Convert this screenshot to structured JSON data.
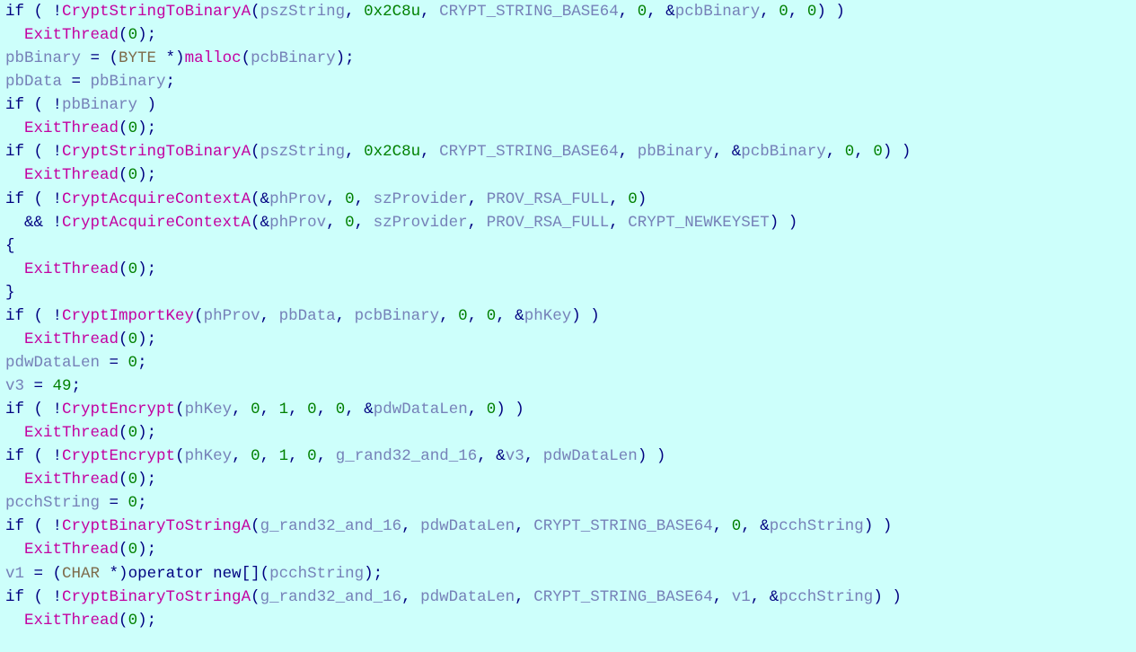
{
  "lines": [
    [
      {
        "cls": "kw",
        "t": "if"
      },
      {
        "cls": "op",
        "t": " ("
      },
      {
        "cls": "op",
        "t": " !"
      },
      {
        "cls": "fn",
        "t": "CryptStringToBinaryA"
      },
      {
        "cls": "op",
        "t": "("
      },
      {
        "cls": "var",
        "t": "pszString"
      },
      {
        "cls": "op",
        "t": ", "
      },
      {
        "cls": "lt",
        "t": "0x2C8u"
      },
      {
        "cls": "op",
        "t": ", "
      },
      {
        "cls": "var",
        "t": "CRYPT_STRING_BASE64"
      },
      {
        "cls": "op",
        "t": ", "
      },
      {
        "cls": "lt",
        "t": "0"
      },
      {
        "cls": "op",
        "t": ", &"
      },
      {
        "cls": "var",
        "t": "pcbBinary"
      },
      {
        "cls": "op",
        "t": ", "
      },
      {
        "cls": "lt",
        "t": "0"
      },
      {
        "cls": "op",
        "t": ", "
      },
      {
        "cls": "lt",
        "t": "0"
      },
      {
        "cls": "op",
        "t": ")"
      },
      {
        "cls": "op",
        "t": " )"
      }
    ],
    [
      {
        "cls": "op",
        "t": "  "
      },
      {
        "cls": "fn",
        "t": "ExitThread"
      },
      {
        "cls": "op",
        "t": "("
      },
      {
        "cls": "lt",
        "t": "0"
      },
      {
        "cls": "op",
        "t": ");"
      }
    ],
    [
      {
        "cls": "var",
        "t": "pbBinary"
      },
      {
        "cls": "op",
        "t": " = ("
      },
      {
        "cls": "ty",
        "t": "BYTE"
      },
      {
        "cls": "op",
        "t": " *)"
      },
      {
        "cls": "fn",
        "t": "malloc"
      },
      {
        "cls": "op",
        "t": "("
      },
      {
        "cls": "var",
        "t": "pcbBinary"
      },
      {
        "cls": "op",
        "t": ");"
      }
    ],
    [
      {
        "cls": "var",
        "t": "pbData"
      },
      {
        "cls": "op",
        "t": " = "
      },
      {
        "cls": "var",
        "t": "pbBinary"
      },
      {
        "cls": "op",
        "t": ";"
      }
    ],
    [
      {
        "cls": "kw",
        "t": "if"
      },
      {
        "cls": "op",
        "t": " ( !"
      },
      {
        "cls": "var",
        "t": "pbBinary"
      },
      {
        "cls": "op",
        "t": " )"
      }
    ],
    [
      {
        "cls": "op",
        "t": "  "
      },
      {
        "cls": "fn",
        "t": "ExitThread"
      },
      {
        "cls": "op",
        "t": "("
      },
      {
        "cls": "lt",
        "t": "0"
      },
      {
        "cls": "op",
        "t": ");"
      }
    ],
    [
      {
        "cls": "kw",
        "t": "if"
      },
      {
        "cls": "op",
        "t": " ( !"
      },
      {
        "cls": "fn",
        "t": "CryptStringToBinaryA"
      },
      {
        "cls": "op",
        "t": "("
      },
      {
        "cls": "var",
        "t": "pszString"
      },
      {
        "cls": "op",
        "t": ", "
      },
      {
        "cls": "lt",
        "t": "0x2C8u"
      },
      {
        "cls": "op",
        "t": ", "
      },
      {
        "cls": "var",
        "t": "CRYPT_STRING_BASE64"
      },
      {
        "cls": "op",
        "t": ", "
      },
      {
        "cls": "var",
        "t": "pbBinary"
      },
      {
        "cls": "op",
        "t": ", &"
      },
      {
        "cls": "var",
        "t": "pcbBinary"
      },
      {
        "cls": "op",
        "t": ", "
      },
      {
        "cls": "lt",
        "t": "0"
      },
      {
        "cls": "op",
        "t": ", "
      },
      {
        "cls": "lt",
        "t": "0"
      },
      {
        "cls": "op",
        "t": ") )"
      }
    ],
    [
      {
        "cls": "op",
        "t": "  "
      },
      {
        "cls": "fn",
        "t": "ExitThread"
      },
      {
        "cls": "op",
        "t": "("
      },
      {
        "cls": "lt",
        "t": "0"
      },
      {
        "cls": "op",
        "t": ");"
      }
    ],
    [
      {
        "cls": "kw",
        "t": "if"
      },
      {
        "cls": "op",
        "t": " ( !"
      },
      {
        "cls": "fn",
        "t": "CryptAcquireContextA"
      },
      {
        "cls": "op",
        "t": "(&"
      },
      {
        "cls": "var",
        "t": "phProv"
      },
      {
        "cls": "op",
        "t": ", "
      },
      {
        "cls": "lt",
        "t": "0"
      },
      {
        "cls": "op",
        "t": ", "
      },
      {
        "cls": "var",
        "t": "szProvider"
      },
      {
        "cls": "op",
        "t": ", "
      },
      {
        "cls": "var",
        "t": "PROV_RSA_FULL"
      },
      {
        "cls": "op",
        "t": ", "
      },
      {
        "cls": "lt",
        "t": "0"
      },
      {
        "cls": "op",
        "t": ")"
      }
    ],
    [
      {
        "cls": "op",
        "t": "  && !"
      },
      {
        "cls": "fn",
        "t": "CryptAcquireContextA"
      },
      {
        "cls": "op",
        "t": "(&"
      },
      {
        "cls": "var",
        "t": "phProv"
      },
      {
        "cls": "op",
        "t": ", "
      },
      {
        "cls": "lt",
        "t": "0"
      },
      {
        "cls": "op",
        "t": ", "
      },
      {
        "cls": "var",
        "t": "szProvider"
      },
      {
        "cls": "op",
        "t": ", "
      },
      {
        "cls": "var",
        "t": "PROV_RSA_FULL"
      },
      {
        "cls": "op",
        "t": ", "
      },
      {
        "cls": "var",
        "t": "CRYPT_NEWKEYSET"
      },
      {
        "cls": "op",
        "t": ") )"
      }
    ],
    [
      {
        "cls": "op",
        "t": "{"
      }
    ],
    [
      {
        "cls": "op",
        "t": "  "
      },
      {
        "cls": "fn",
        "t": "ExitThread"
      },
      {
        "cls": "op",
        "t": "("
      },
      {
        "cls": "lt",
        "t": "0"
      },
      {
        "cls": "op",
        "t": ");"
      }
    ],
    [
      {
        "cls": "op",
        "t": "}"
      }
    ],
    [
      {
        "cls": "kw",
        "t": "if"
      },
      {
        "cls": "op",
        "t": " ( !"
      },
      {
        "cls": "fn",
        "t": "CryptImportKey"
      },
      {
        "cls": "op",
        "t": "("
      },
      {
        "cls": "var",
        "t": "phProv"
      },
      {
        "cls": "op",
        "t": ", "
      },
      {
        "cls": "var",
        "t": "pbData"
      },
      {
        "cls": "op",
        "t": ", "
      },
      {
        "cls": "var",
        "t": "pcbBinary"
      },
      {
        "cls": "op",
        "t": ", "
      },
      {
        "cls": "lt",
        "t": "0"
      },
      {
        "cls": "op",
        "t": ", "
      },
      {
        "cls": "lt",
        "t": "0"
      },
      {
        "cls": "op",
        "t": ", &"
      },
      {
        "cls": "var",
        "t": "phKey"
      },
      {
        "cls": "op",
        "t": ") )"
      }
    ],
    [
      {
        "cls": "op",
        "t": "  "
      },
      {
        "cls": "fn",
        "t": "ExitThread"
      },
      {
        "cls": "op",
        "t": "("
      },
      {
        "cls": "lt",
        "t": "0"
      },
      {
        "cls": "op",
        "t": ");"
      }
    ],
    [
      {
        "cls": "var",
        "t": "pdwDataLen"
      },
      {
        "cls": "op",
        "t": " = "
      },
      {
        "cls": "lt",
        "t": "0"
      },
      {
        "cls": "op",
        "t": ";"
      }
    ],
    [
      {
        "cls": "var",
        "t": "v3"
      },
      {
        "cls": "op",
        "t": " = "
      },
      {
        "cls": "lt",
        "t": "49"
      },
      {
        "cls": "op",
        "t": ";"
      }
    ],
    [
      {
        "cls": "kw",
        "t": "if"
      },
      {
        "cls": "op",
        "t": " ( !"
      },
      {
        "cls": "fn",
        "t": "CryptEncrypt"
      },
      {
        "cls": "op",
        "t": "("
      },
      {
        "cls": "var",
        "t": "phKey"
      },
      {
        "cls": "op",
        "t": ", "
      },
      {
        "cls": "lt",
        "t": "0"
      },
      {
        "cls": "op",
        "t": ", "
      },
      {
        "cls": "lt",
        "t": "1"
      },
      {
        "cls": "op",
        "t": ", "
      },
      {
        "cls": "lt",
        "t": "0"
      },
      {
        "cls": "op",
        "t": ", "
      },
      {
        "cls": "lt",
        "t": "0"
      },
      {
        "cls": "op",
        "t": ", &"
      },
      {
        "cls": "var",
        "t": "pdwDataLen"
      },
      {
        "cls": "op",
        "t": ", "
      },
      {
        "cls": "lt",
        "t": "0"
      },
      {
        "cls": "op",
        "t": ") )"
      }
    ],
    [
      {
        "cls": "op",
        "t": "  "
      },
      {
        "cls": "fn",
        "t": "ExitThread"
      },
      {
        "cls": "op",
        "t": "("
      },
      {
        "cls": "lt",
        "t": "0"
      },
      {
        "cls": "op",
        "t": ");"
      }
    ],
    [
      {
        "cls": "kw",
        "t": "if"
      },
      {
        "cls": "op",
        "t": " ( !"
      },
      {
        "cls": "fn",
        "t": "CryptEncrypt"
      },
      {
        "cls": "op",
        "t": "("
      },
      {
        "cls": "var",
        "t": "phKey"
      },
      {
        "cls": "op",
        "t": ", "
      },
      {
        "cls": "lt",
        "t": "0"
      },
      {
        "cls": "op",
        "t": ", "
      },
      {
        "cls": "lt",
        "t": "1"
      },
      {
        "cls": "op",
        "t": ", "
      },
      {
        "cls": "lt",
        "t": "0"
      },
      {
        "cls": "op",
        "t": ", "
      },
      {
        "cls": "var",
        "t": "g_rand32_and_16"
      },
      {
        "cls": "op",
        "t": ", &"
      },
      {
        "cls": "var",
        "t": "v3"
      },
      {
        "cls": "op",
        "t": ", "
      },
      {
        "cls": "var",
        "t": "pdwDataLen"
      },
      {
        "cls": "op",
        "t": ") )"
      }
    ],
    [
      {
        "cls": "op",
        "t": "  "
      },
      {
        "cls": "fn",
        "t": "ExitThread"
      },
      {
        "cls": "op",
        "t": "("
      },
      {
        "cls": "lt",
        "t": "0"
      },
      {
        "cls": "op",
        "t": ");"
      }
    ],
    [
      {
        "cls": "var",
        "t": "pcchString"
      },
      {
        "cls": "op",
        "t": " = "
      },
      {
        "cls": "lt",
        "t": "0"
      },
      {
        "cls": "op",
        "t": ";"
      }
    ],
    [
      {
        "cls": "kw",
        "t": "if"
      },
      {
        "cls": "op",
        "t": " ( !"
      },
      {
        "cls": "fn",
        "t": "CryptBinaryToStringA"
      },
      {
        "cls": "op",
        "t": "("
      },
      {
        "cls": "var",
        "t": "g_rand32_and_16"
      },
      {
        "cls": "op",
        "t": ", "
      },
      {
        "cls": "var",
        "t": "pdwDataLen"
      },
      {
        "cls": "op",
        "t": ", "
      },
      {
        "cls": "var",
        "t": "CRYPT_STRING_BASE64"
      },
      {
        "cls": "op",
        "t": ", "
      },
      {
        "cls": "lt",
        "t": "0"
      },
      {
        "cls": "op",
        "t": ", &"
      },
      {
        "cls": "var",
        "t": "pcchString"
      },
      {
        "cls": "op",
        "t": ") )"
      }
    ],
    [
      {
        "cls": "op",
        "t": "  "
      },
      {
        "cls": "fn",
        "t": "ExitThread"
      },
      {
        "cls": "op",
        "t": "("
      },
      {
        "cls": "lt",
        "t": "0"
      },
      {
        "cls": "op",
        "t": ");"
      }
    ],
    [
      {
        "cls": "var",
        "t": "v1"
      },
      {
        "cls": "op",
        "t": " = ("
      },
      {
        "cls": "ty",
        "t": "CHAR"
      },
      {
        "cls": "op",
        "t": " *)"
      },
      {
        "cls": "kw",
        "t": "operator new"
      },
      {
        "cls": "op",
        "t": "[]("
      },
      {
        "cls": "var",
        "t": "pcchString"
      },
      {
        "cls": "op",
        "t": ");"
      }
    ],
    [
      {
        "cls": "kw",
        "t": "if"
      },
      {
        "cls": "op",
        "t": " ( !"
      },
      {
        "cls": "fn",
        "t": "CryptBinaryToStringA"
      },
      {
        "cls": "op",
        "t": "("
      },
      {
        "cls": "var",
        "t": "g_rand32_and_16"
      },
      {
        "cls": "op",
        "t": ", "
      },
      {
        "cls": "var",
        "t": "pdwDataLen"
      },
      {
        "cls": "op",
        "t": ", "
      },
      {
        "cls": "var",
        "t": "CRYPT_STRING_BASE64"
      },
      {
        "cls": "op",
        "t": ", "
      },
      {
        "cls": "var",
        "t": "v1"
      },
      {
        "cls": "op",
        "t": ", &"
      },
      {
        "cls": "var",
        "t": "pcchString"
      },
      {
        "cls": "op",
        "t": ") )"
      }
    ],
    [
      {
        "cls": "op",
        "t": "  "
      },
      {
        "cls": "fn",
        "t": "ExitThread"
      },
      {
        "cls": "op",
        "t": "("
      },
      {
        "cls": "lt",
        "t": "0"
      },
      {
        "cls": "op",
        "t": ");"
      }
    ]
  ]
}
